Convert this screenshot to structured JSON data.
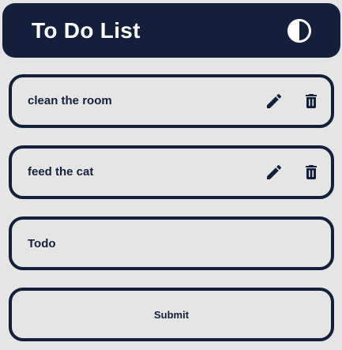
{
  "header": {
    "title": "To Do List",
    "theme_toggle_icon": "contrast-half-circle-icon"
  },
  "todos": [
    {
      "text": "clean the room",
      "edit_icon": "pencil-icon",
      "delete_icon": "trash-icon"
    },
    {
      "text": "feed the cat",
      "edit_icon": "pencil-icon",
      "delete_icon": "trash-icon"
    }
  ],
  "form": {
    "input_value": "",
    "input_placeholder": "Todo",
    "submit_label": "Submit"
  },
  "colors": {
    "primary": "#13203c",
    "background": "#e5e5e5",
    "header_text": "#ffffff"
  }
}
